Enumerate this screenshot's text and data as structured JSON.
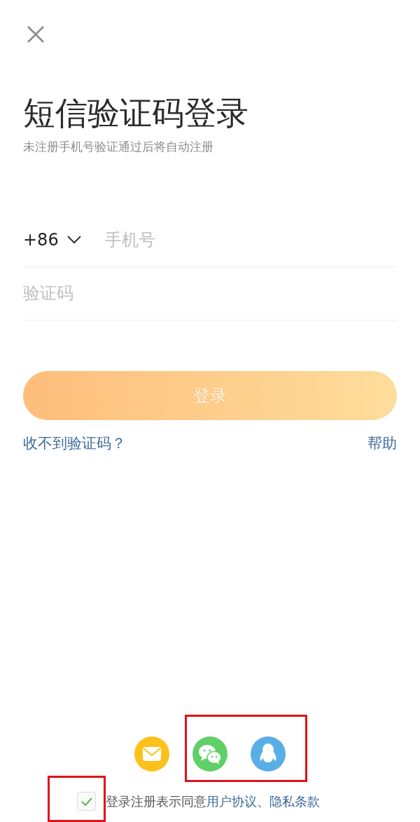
{
  "title": "短信验证码登录",
  "subtitle": "未注册手机号验证通过后将自动注册",
  "phone": {
    "country_code": "+86",
    "placeholder": "手机号"
  },
  "code": {
    "placeholder": "验证码"
  },
  "login_button": {
    "label": "登录",
    "disabled": true
  },
  "links": [
    {
      "label": "收不到验证码？"
    },
    {
      "label": "帮助"
    }
  ],
  "social_login_groups": [
    {
      "highlighted": false,
      "buttons": [
        {
          "kind": "mail",
          "color": "#fcc21b"
        }
      ]
    },
    {
      "highlighted": true,
      "buttons": [
        {
          "kind": "wechat",
          "color": "#5fcf68"
        },
        {
          "kind": "qq",
          "color": "#5aaee6"
        }
      ]
    }
  ],
  "agreement": {
    "checked": true,
    "highlighted": true,
    "text": "登录注册表示同意",
    "links": [
      "用户协议",
      "隐私条款"
    ],
    "separator": "、"
  }
}
